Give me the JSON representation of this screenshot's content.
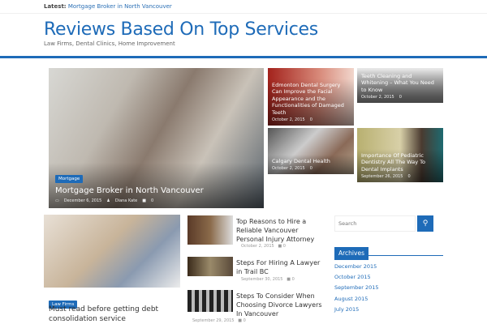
{
  "latest": {
    "label": "Latest:",
    "link": "Mortgage Broker in North Vancouver"
  },
  "site": {
    "title": "Reviews Based On Top Services",
    "tagline": "Law Firms, Dental Clinics, Home Improvement"
  },
  "featured": {
    "category": "Mortgage",
    "title": "Mortgage Broker in North Vancouver",
    "date": "December 6, 2015",
    "author": "Diana Kate",
    "comments": "0"
  },
  "grid": [
    {
      "title": "Edmonton Dental Surgery Can Improve the Facial Appearance and the Functionalities of Damaged Teeth",
      "date": "October 2, 2015",
      "comments": "0"
    },
    {
      "title": "Teeth Cleaning and Whitening – What You Need to Know",
      "date": "October 2, 2015",
      "comments": "0"
    },
    {
      "title": "Calgary Dental Health",
      "date": "October 2, 2015",
      "comments": "0"
    },
    {
      "title": "Importance Of Pediatric Dentistry All The Way To Dental Implants",
      "date": "September 26, 2015",
      "comments": "0"
    }
  ],
  "main_post": {
    "category": "Law Firms",
    "title": "Must read before getting debt consolidation service"
  },
  "list": [
    {
      "title": "Top Reasons to Hire a Reliable Vancouver Personal Injury Attorney",
      "date": "October 2, 2015",
      "comments": "0"
    },
    {
      "title": "Steps For Hiring A Lawyer in Trail BC",
      "date": "September 30, 2015",
      "comments": "0"
    },
    {
      "title": "Steps To Consider When Choosing Divorce Lawyers In Vancouver",
      "date": "September 29, 2015",
      "comments": "0"
    }
  ],
  "sidebar": {
    "search_placeholder": "Search",
    "archives_title": "Archives",
    "archives": [
      "December 2015",
      "October 2015",
      "September 2015",
      "August 2015",
      "July 2015"
    ]
  }
}
